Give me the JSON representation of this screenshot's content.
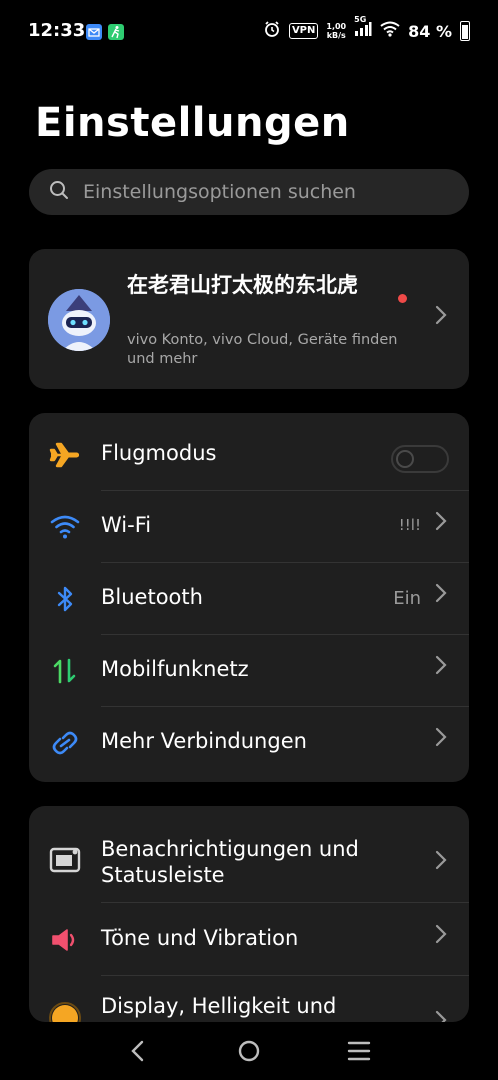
{
  "status": {
    "time": "12:33",
    "vpn": "VPN",
    "speed_value": "1,00",
    "speed_unit": "kB/s",
    "network": "5G",
    "battery": "84 %"
  },
  "page": {
    "title": "Einstellungen",
    "search_placeholder": "Einstellungsoptionen suchen"
  },
  "account": {
    "name": "在老君山打太极的东北虎",
    "subtitle": "vivo Konto, vivo Cloud, Geräte finden und mehr"
  },
  "connections": [
    {
      "label": "Flugmodus",
      "icon": "airplane-icon",
      "control": "toggle",
      "on": false
    },
    {
      "label": "Wi-Fi",
      "icon": "wifi-icon",
      "value": "!!l!"
    },
    {
      "label": "Bluetooth",
      "icon": "bluetooth-icon",
      "value": "Ein"
    },
    {
      "label": "Mobilfunknetz",
      "icon": "mobile-data-icon"
    },
    {
      "label": "Mehr Verbindungen",
      "icon": "link-icon"
    }
  ],
  "system": [
    {
      "label": "Benachrichtigungen und Statusleiste",
      "icon": "notification-icon"
    },
    {
      "label": "Töne und Vibration",
      "icon": "speaker-icon"
    },
    {
      "label": "Display, Helligkeit und",
      "icon": "display-icon"
    }
  ],
  "colors": {
    "background": "#000000",
    "card": "#1f1f1f",
    "airplane": "#f5a623",
    "wifi": "#3d8af7",
    "bluetooth": "#3d8af7",
    "mobile_up": "#4cd964",
    "mobile_down": "#2ecc71",
    "sound": "#f0506e",
    "display": "#f5a623",
    "badge": "#ef4a48"
  }
}
